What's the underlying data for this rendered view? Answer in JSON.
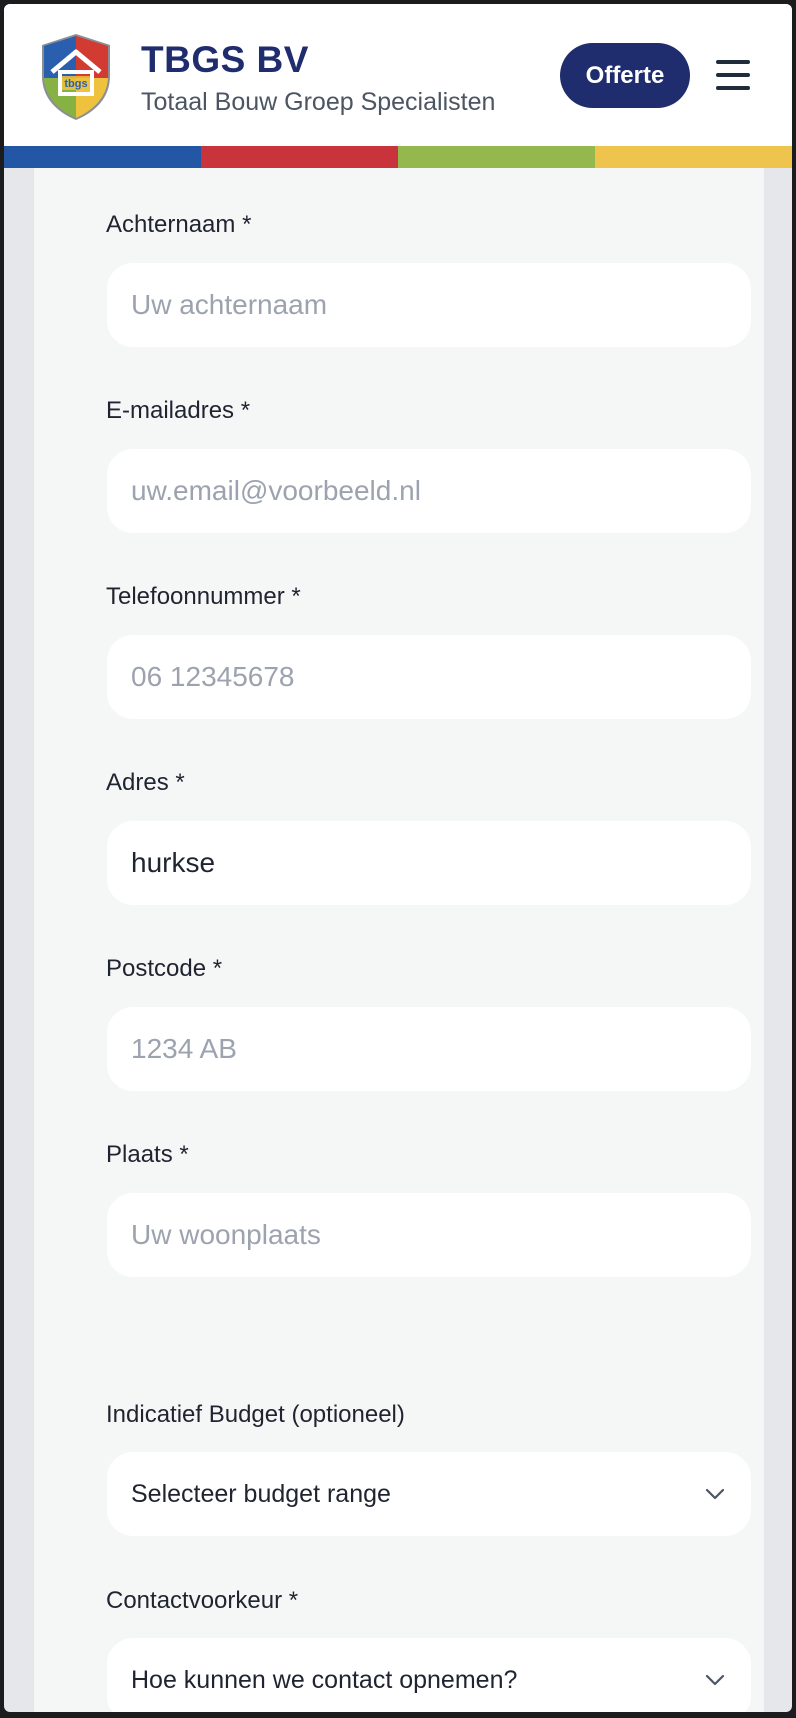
{
  "header": {
    "brand_title": "TBGS BV",
    "brand_subtitle": "Totaal Bouw Groep Specialisten",
    "offerte_label": "Offerte",
    "logo_icon": "house-shield-logo-icon",
    "menu_icon": "hamburger-menu-icon"
  },
  "stripe_colors": [
    "#2456a6",
    "#c9343c",
    "#95b84e",
    "#eec44c"
  ],
  "colors": {
    "brand": "#1f2d6e",
    "card_bg": "#f5f6f6",
    "placeholder": "#9ca3af"
  },
  "form": {
    "achternaam": {
      "label": "Achternaam *",
      "placeholder": "Uw achternaam",
      "value": ""
    },
    "email": {
      "label": "E-mailadres *",
      "placeholder": "uw.email@voorbeeld.nl",
      "value": ""
    },
    "telefoon": {
      "label": "Telefoonnummer *",
      "placeholder": "06 12345678",
      "value": ""
    },
    "adres": {
      "label": "Adres *",
      "placeholder": "",
      "value": "hurkse"
    },
    "postcode": {
      "label": "Postcode *",
      "placeholder": "1234 AB",
      "value": ""
    },
    "plaats": {
      "label": "Plaats *",
      "placeholder": "Uw woonplaats",
      "value": ""
    },
    "budget": {
      "label": "Indicatief Budget (optioneel)",
      "selected": "Selecteer budget range"
    },
    "contact": {
      "label": "Contactvoorkeur *",
      "selected": "Hoe kunnen we contact opnemen?"
    }
  }
}
